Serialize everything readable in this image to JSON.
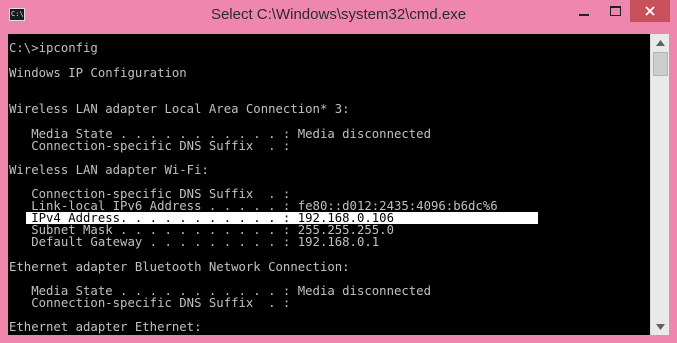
{
  "window": {
    "title": "Select C:\\Windows\\system32\\cmd.exe",
    "icon_text": "C:\\",
    "accent": "#ef86ae",
    "close_color": "#c7505a"
  },
  "console": {
    "lines": [
      "C:\\>ipconfig",
      "",
      "Windows IP Configuration",
      "",
      "",
      "Wireless LAN adapter Local Area Connection* 3:",
      "",
      "   Media State . . . . . . . . . . . : Media disconnected",
      "   Connection-specific DNS Suffix  . :",
      "",
      "Wireless LAN adapter Wi-Fi:",
      "",
      "   Connection-specific DNS Suffix  . :",
      "   Link-local IPv6 Address . . . . . : fe80::d012:2435:4096:b6dc%6",
      "   IPv4 Address. . . . . . . . . . . : 192.168.0.106",
      "   Subnet Mask . . . . . . . . . . . : 255.255.255.0",
      "   Default Gateway . . . . . . . . . : 192.168.0.1",
      "",
      "Ethernet adapter Bluetooth Network Connection:",
      "",
      "   Media State . . . . . . . . . . . : Media disconnected",
      "   Connection-specific DNS Suffix  . :",
      "",
      "Ethernet adapter Ethernet:"
    ]
  },
  "scrollbar": {
    "up_icon": "arrow-up-icon",
    "down_icon": "arrow-down-icon"
  }
}
